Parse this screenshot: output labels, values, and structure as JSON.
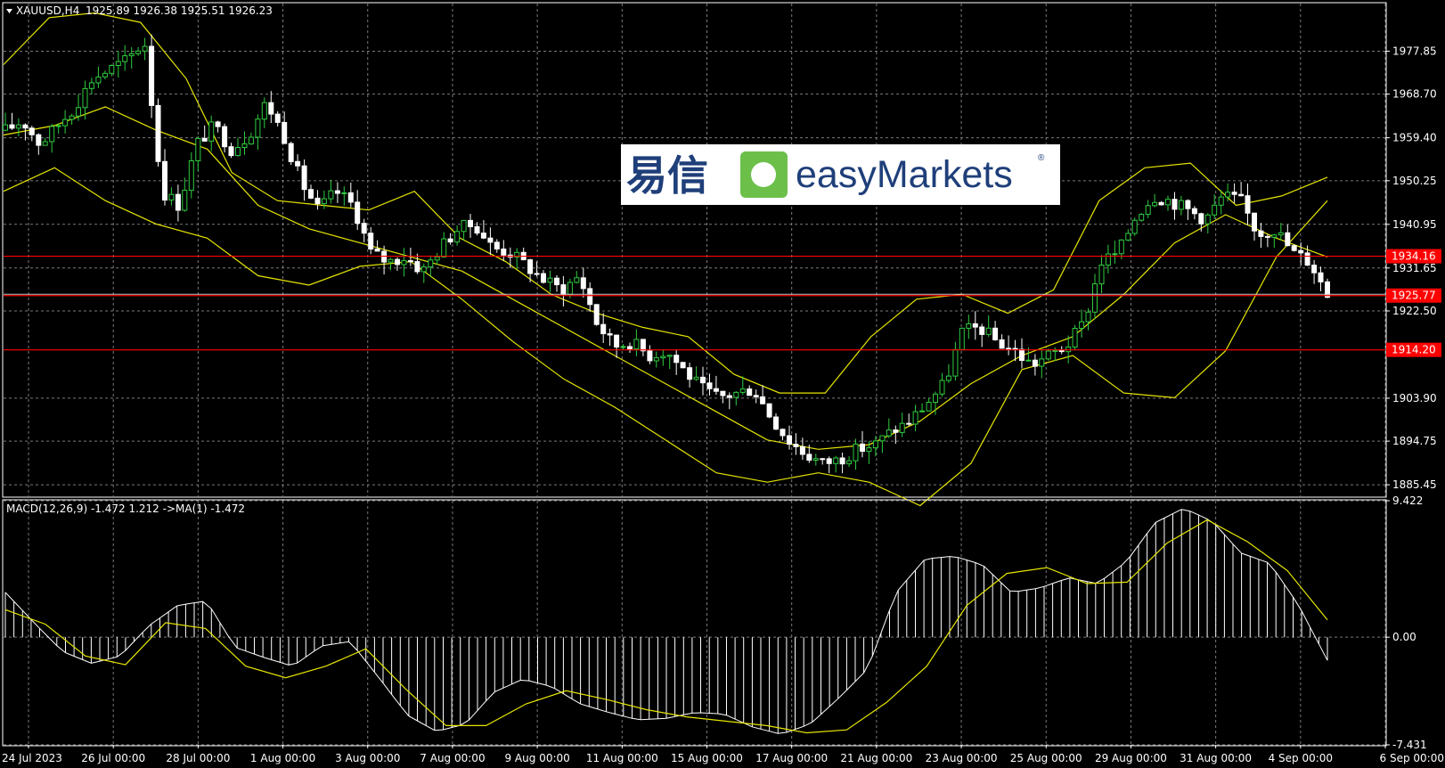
{
  "main_header": {
    "symbol": "XAUUSD,H4",
    "ohlc": "1925.89 1926.38 1925.51 1926.23"
  },
  "macd_header": "MACD(12,26,9) -1.472 1.212  ->MA(1) -1.472",
  "logo": {
    "chinese": "易信",
    "brand": "easyMarkets",
    "reg": "®"
  },
  "colors": {
    "background": "#000000",
    "grid": "#7a7a7a",
    "bull_candle": "#2ecc40",
    "bear_candle": "#ffffff",
    "bands": "#e6e600",
    "hline": "#ff0000",
    "macd_hist": "#ffffff",
    "macd_signal": "#e6e600",
    "text": "#ffffff"
  },
  "chart_data": [
    {
      "type": "candlestick",
      "symbol": "XAUUSD",
      "timeframe": "H4",
      "price_ticks": [
        "1977.85",
        "1968.70",
        "1959.40",
        "1950.25",
        "1940.95",
        "1931.65",
        "1922.50",
        "1903.90",
        "1894.75",
        "1885.45"
      ],
      "ylim": [
        1883,
        1988
      ],
      "x_labels": [
        "24 Jul 2023",
        "26 Jul 00:00",
        "28 Jul 00:00",
        "1 Aug 00:00",
        "3 Aug 00:00",
        "7 Aug 00:00",
        "9 Aug 00:00",
        "11 Aug 00:00",
        "15 Aug 00:00",
        "17 Aug 00:00",
        "21 Aug 00:00",
        "23 Aug 00:00",
        "25 Aug 00:00",
        "29 Aug 00:00",
        "31 Aug 00:00",
        "4 Sep 00:00",
        "6 Sep 00:00"
      ],
      "close_path": [
        1961,
        1963,
        1958,
        1962,
        1966,
        1972,
        1974,
        1976,
        1980,
        1948,
        1945,
        1958,
        1962,
        1957,
        1960,
        1967,
        1960,
        1950,
        1944,
        1948,
        1945,
        1935,
        1933,
        1934,
        1931,
        1936,
        1940,
        1941,
        1936,
        1935,
        1932,
        1929,
        1927,
        1930,
        1920,
        1915,
        1916,
        1913,
        1914,
        1910,
        1906,
        1904,
        1905,
        1906,
        1900,
        1895,
        1892,
        1890,
        1891,
        1893,
        1894,
        1897,
        1899,
        1903,
        1907,
        1918,
        1919,
        1916,
        1914,
        1911,
        1913,
        1915,
        1920,
        1933,
        1935,
        1943,
        1947,
        1946,
        1944,
        1942,
        1947,
        1946,
        1939,
        1940,
        1935,
        1933,
        1926
      ],
      "bands": {
        "upper": [
          1975,
          1985,
          1986,
          1984,
          1972,
          1952,
          1946,
          1945,
          1944,
          1948,
          1938,
          1933,
          1926,
          1922,
          1919,
          1917,
          1909,
          1905,
          1905,
          1917,
          1925,
          1926,
          1922,
          1927,
          1946,
          1953,
          1954,
          1945,
          1947,
          1951
        ],
        "middle": [
          1960,
          1962,
          1966,
          1961,
          1957,
          1945,
          1940,
          1937,
          1934,
          1931,
          1925,
          1919,
          1913,
          1907,
          1901,
          1895,
          1893,
          1894,
          1899,
          1907,
          1913,
          1917,
          1926,
          1937,
          1943,
          1938,
          1934
        ],
        "lower": [
          1948,
          1953,
          1946,
          1941,
          1938,
          1930,
          1928,
          1932,
          1933,
          1925,
          1916,
          1908,
          1902,
          1895,
          1888,
          1886,
          1888,
          1886,
          1881,
          1890,
          1910,
          1913,
          1905,
          1904,
          1914,
          1934,
          1946
        ]
      },
      "hlines": [
        {
          "value": "1934.16",
          "color": "#ff0000"
        },
        {
          "value": "1925.77",
          "color": "#ff0000"
        },
        {
          "value": "1914.20",
          "color": "#ff0000"
        }
      ],
      "current_price": "1925.77"
    },
    {
      "type": "histogram",
      "name": "MACD(12,26,9)",
      "y_ticks": [
        "9.422",
        "0.00",
        "-7.431"
      ],
      "ylim": [
        -7.431,
        9.422
      ],
      "histogram": [
        3.1,
        1.0,
        -1.0,
        -1.8,
        -1.3,
        0.8,
        2.2,
        2.5,
        -0.7,
        -1.4,
        -2.0,
        -0.6,
        -0.3,
        -2.8,
        -5.4,
        -6.5,
        -6.0,
        -3.8,
        -2.9,
        -3.4,
        -4.6,
        -5.2,
        -5.7,
        -5.6,
        -5.2,
        -5.3,
        -6.2,
        -6.7,
        -6.0,
        -4.2,
        -2.2,
        3.1,
        5.4,
        5.6,
        5.0,
        3.1,
        3.4,
        4.1,
        3.7,
        5.2,
        7.9,
        8.9,
        8.0,
        5.8,
        5.1,
        2.2,
        -1.6
      ],
      "signal": [
        1.9,
        0.9,
        -1.3,
        -1.9,
        1.0,
        0.6,
        -2.0,
        -2.8,
        -2.0,
        -0.8,
        -3.6,
        -6.1,
        -6.1,
        -4.6,
        -3.7,
        -4.3,
        -5.0,
        -5.5,
        -5.8,
        -6.1,
        -6.6,
        -6.4,
        -4.5,
        -2.0,
        2.2,
        4.4,
        4.8,
        3.7,
        3.8,
        6.5,
        8.1,
        6.6,
        4.6,
        1.2
      ],
      "current": "-1.472"
    }
  ]
}
